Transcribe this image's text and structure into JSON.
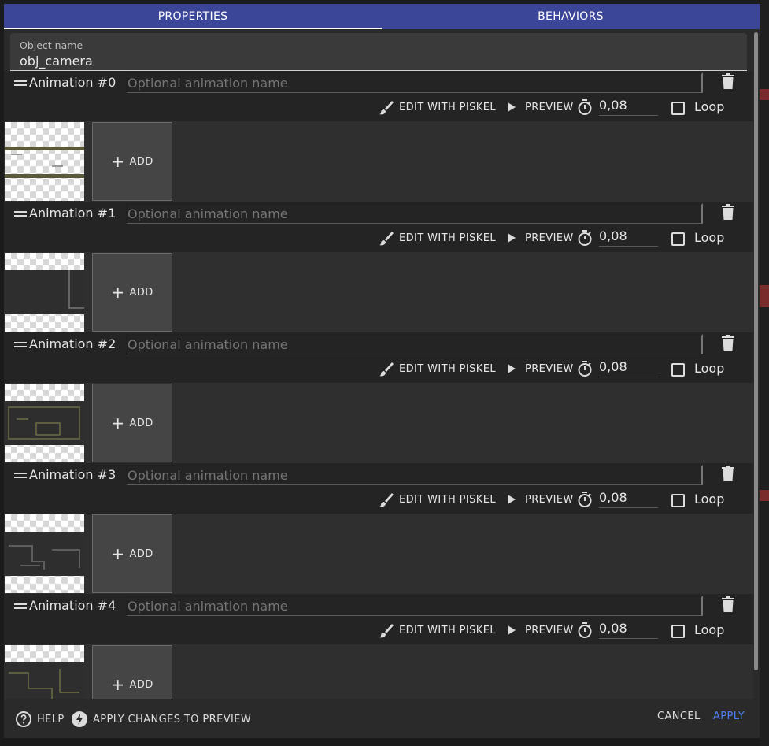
{
  "tabs": [
    {
      "label": "PROPERTIES",
      "active": true
    },
    {
      "label": "BEHAVIORS",
      "active": false
    }
  ],
  "object_name": {
    "label": "Object name",
    "value": "obj_camera"
  },
  "animations": [
    {
      "title": "Animation #0",
      "name_placeholder": "Optional animation name",
      "edit_label": "EDIT WITH PISKEL",
      "preview_label": "PREVIEW",
      "timer": "0,08",
      "loop_label": "Loop",
      "add_label": "ADD"
    },
    {
      "title": "Animation #1",
      "name_placeholder": "Optional animation name",
      "edit_label": "EDIT WITH PISKEL",
      "preview_label": "PREVIEW",
      "timer": "0,08",
      "loop_label": "Loop",
      "add_label": "ADD"
    },
    {
      "title": "Animation #2",
      "name_placeholder": "Optional animation name",
      "edit_label": "EDIT WITH PISKEL",
      "preview_label": "PREVIEW",
      "timer": "0,08",
      "loop_label": "Loop",
      "add_label": "ADD"
    },
    {
      "title": "Animation #3",
      "name_placeholder": "Optional animation name",
      "edit_label": "EDIT WITH PISKEL",
      "preview_label": "PREVIEW",
      "timer": "0,08",
      "loop_label": "Loop",
      "add_label": "ADD"
    },
    {
      "title": "Animation #4",
      "name_placeholder": "Optional animation name",
      "edit_label": "EDIT WITH PISKEL",
      "preview_label": "PREVIEW",
      "timer": "0,08",
      "loop_label": "Loop",
      "add_label": "ADD"
    }
  ],
  "footer": {
    "help_label": "HELP",
    "apply_preview_label": "APPLY CHANGES TO PREVIEW",
    "cancel_label": "CANCEL",
    "apply_label": "APPLY"
  },
  "colors": {
    "tab_bar": "#3c4698",
    "accent": "#4f7ff0",
    "dialog_bg": "#2a2a2a"
  }
}
